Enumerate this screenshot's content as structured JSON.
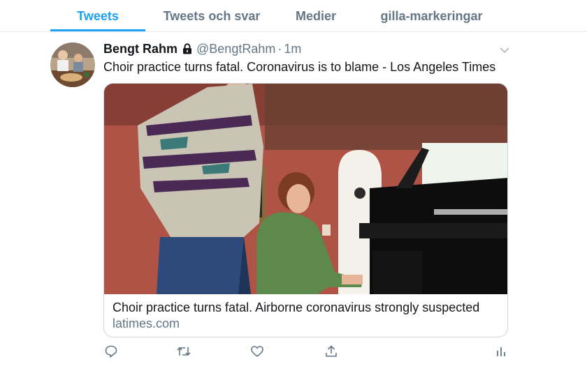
{
  "tabs": [
    {
      "label": "Tweets",
      "active": true
    },
    {
      "label": "Tweets och svar",
      "active": false
    },
    {
      "label": "Medier",
      "active": false
    },
    {
      "label": "gilla-markeringar",
      "active": false
    }
  ],
  "colors": {
    "accent": "#1da1f2",
    "secondary_text": "#657786",
    "primary_text": "#14171a",
    "border": "#ccd6dd"
  },
  "tweet": {
    "display_name": "Bengt Rahm",
    "protected_icon": "lock-icon",
    "handle": "@BengtRahm",
    "separator": "·",
    "time": "1m",
    "text": "Choir practice turns fatal. Coronavirus is to blame - Los Angeles Times",
    "card": {
      "title": "Choir practice turns fatal. Airborne coronavirus strongly suspected",
      "domain": "latimes.com"
    },
    "actions": [
      "reply-icon",
      "retweet-icon",
      "like-icon",
      "share-icon",
      "analytics-icon"
    ]
  }
}
